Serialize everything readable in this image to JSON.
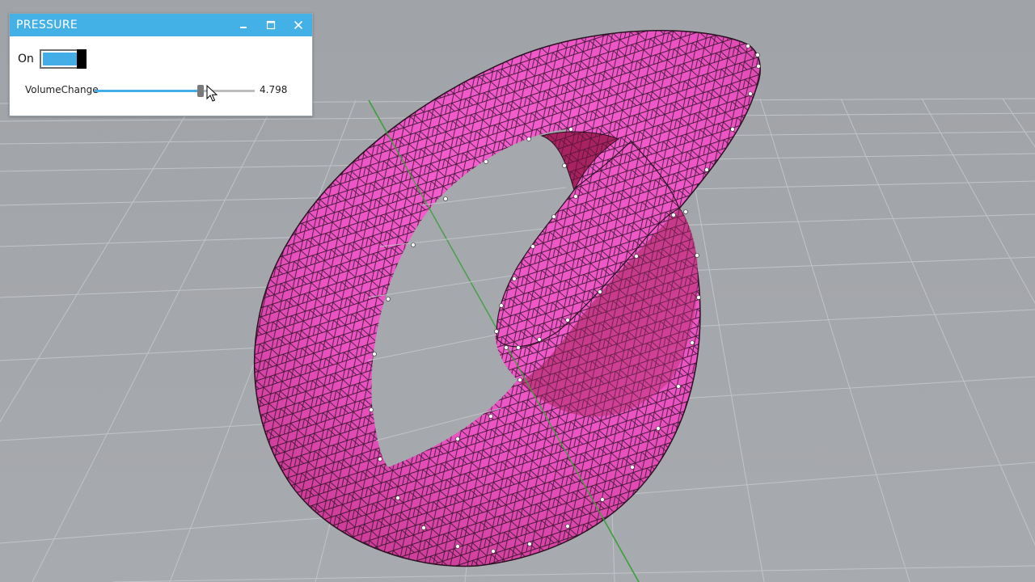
{
  "panel": {
    "title": "PRESSURE",
    "toggle_label": "On",
    "toggle_on": true,
    "slider": {
      "label": "VolumeChange",
      "value_text": "4.798",
      "fraction": 0.66
    }
  },
  "colors": {
    "titlebar": "#43b0e6",
    "accent": "#42ade6",
    "viewport_bg": "#a4a7ab",
    "mesh_face": "#ee57c6",
    "mesh_face_shade": "#c43c8f",
    "grid_line": "#c4c7cb",
    "axis_green": "#3f9f3f"
  },
  "icons": {
    "minimize": "minimize-icon",
    "maximize": "maximize-icon",
    "close": "close-icon",
    "cursor": "mouse-pointer-icon"
  }
}
